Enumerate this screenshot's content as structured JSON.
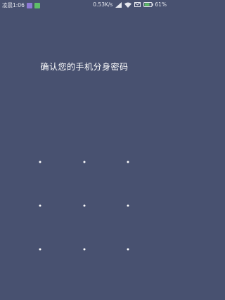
{
  "status_bar": {
    "time": "凌晨1:06",
    "network_speed": "0.53K/s",
    "battery_percent": "61%",
    "left_icons": [
      "app-notification-icon",
      "download-notification-icon"
    ],
    "right_icons": [
      "signal-icon",
      "wifi-icon",
      "mail-icon",
      "battery-icon"
    ],
    "colors": {
      "purple_icon": "#8e79d6",
      "green_icon": "#5fbf68",
      "battery_fill": "#5fbf68"
    }
  },
  "lock_screen": {
    "title": "确认您的手机分身密码",
    "background": "#485170",
    "pattern_dots": 9
  }
}
